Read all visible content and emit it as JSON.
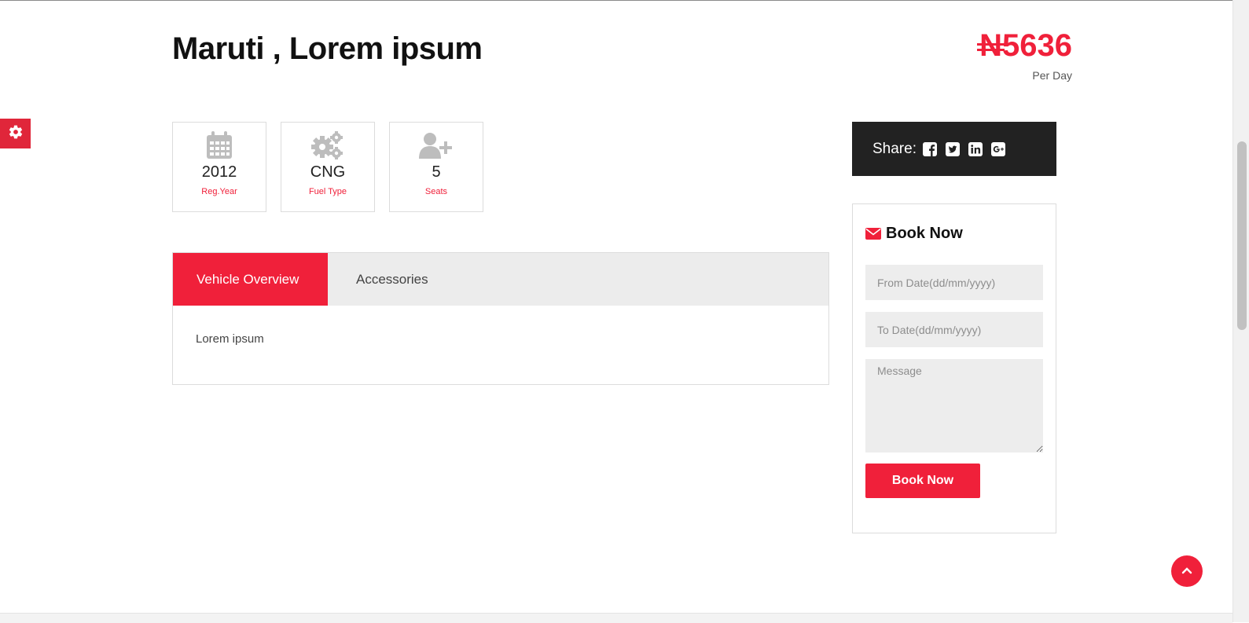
{
  "listing": {
    "title": "Maruti , Lorem ipsum",
    "currency_symbol": "N",
    "price_amount": "5636",
    "price_unit": "Per Day"
  },
  "specs": [
    {
      "icon": "calendar-icon",
      "value": "2012",
      "label": "Reg.Year"
    },
    {
      "icon": "gears-icon",
      "value": "CNG",
      "label": "Fuel Type"
    },
    {
      "icon": "user-plus-icon",
      "value": "5",
      "label": "Seats"
    }
  ],
  "tabs": {
    "items": [
      {
        "label": "Vehicle Overview",
        "active": true
      },
      {
        "label": "Accessories",
        "active": false
      }
    ],
    "content": "Lorem ipsum"
  },
  "share": {
    "label": "Share:",
    "icons": [
      "facebook-icon",
      "twitter-icon",
      "linkedin-icon",
      "google-plus-icon"
    ]
  },
  "booking": {
    "title": "Book Now",
    "from_placeholder": "From Date(dd/mm/yyyy)",
    "to_placeholder": "To Date(dd/mm/yyyy)",
    "message_placeholder": "Message",
    "button_label": "Book Now"
  },
  "colors": {
    "accent": "#f0203a",
    "dark": "#222222",
    "field_bg": "#ededed"
  }
}
